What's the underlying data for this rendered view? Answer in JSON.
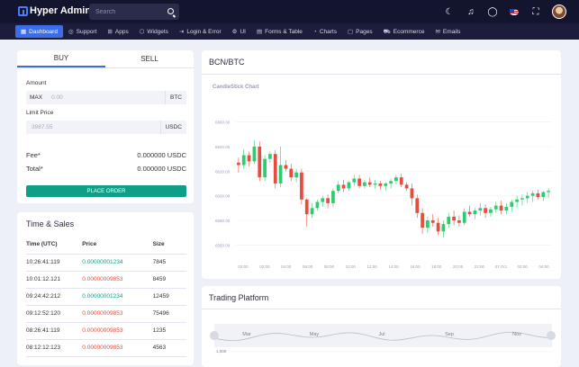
{
  "app": {
    "title": "Hyper Admin"
  },
  "search": {
    "placeholder": "Search"
  },
  "topbar": {
    "icons": [
      "moon-icon",
      "bell-icon",
      "chat-icon",
      "flag-us-icon",
      "fullscreen-icon",
      "avatar"
    ]
  },
  "nav": [
    {
      "label": "Dashboard",
      "icon": "▦",
      "active": true
    },
    {
      "label": "Support",
      "icon": "◎"
    },
    {
      "label": "Apps",
      "icon": "⊞"
    },
    {
      "label": "Widgets",
      "icon": "⬡"
    },
    {
      "label": "Login & Error",
      "icon": "⇥"
    },
    {
      "label": "UI",
      "icon": "⚙"
    },
    {
      "label": "Forms & Table",
      "icon": "▤"
    },
    {
      "label": "Charts",
      "icon": "◔"
    },
    {
      "label": "Pages",
      "icon": "▢"
    },
    {
      "label": "Ecommerce",
      "icon": "⛟"
    },
    {
      "label": "Emails",
      "icon": "✉"
    }
  ],
  "trade": {
    "buy_tab": "BUY",
    "sell_tab": "SELL",
    "amount_label": "Amount",
    "amount_prefix": "MAX",
    "amount_value": "0.00",
    "amount_suffix": "BTC",
    "limit_label": "Limit Price",
    "limit_value": "3987.55",
    "limit_suffix": "USDC",
    "fee_label": "Fee*",
    "fee_value": "0.000000 USDC",
    "total_label": "Total*",
    "total_value": "0.000000 USDC",
    "button": "PLACE ORDER"
  },
  "time_sales": {
    "title": "Time & Sales",
    "headers": [
      "Time (UTC)",
      "Price",
      "Size"
    ],
    "rows": [
      {
        "time": "10:26:41:119",
        "price": "0.00000001234",
        "size": "7845",
        "dir": "up"
      },
      {
        "time": "10:01:12.121",
        "price": "0.00000009853",
        "size": "8459",
        "dir": "dn"
      },
      {
        "time": "09:24:42:212",
        "price": "0.00000001234",
        "size": "12459",
        "dir": "up"
      },
      {
        "time": "09:12:52:120",
        "price": "0.00000009853",
        "size": "75496",
        "dir": "dn"
      },
      {
        "time": "08:26:41:119",
        "price": "0.00000009853",
        "size": "1235",
        "dir": "dn"
      },
      {
        "time": "08:12:12:123",
        "price": "0.00000009853",
        "size": "4563",
        "dir": "dn"
      }
    ]
  },
  "chart_card": {
    "title": "BCN/BTC"
  },
  "chart_data": {
    "type": "candlestick",
    "title": "CandleStick Chart",
    "y_ticks": [
      "6660.00",
      "6640.00",
      "6620.00",
      "6600.00",
      "6580.00",
      "6560.00"
    ],
    "ylim": [
      6550,
      6670
    ],
    "x_ticks": [
      "03:00",
      "02:00",
      "04:00",
      "06:00",
      "08:00",
      "10:00",
      "12:00",
      "14:00",
      "16:00",
      "18:00",
      "20:00",
      "22:00",
      "07 Oct",
      "02:00",
      "04:00"
    ],
    "up_color": "#2ecc71",
    "down_color": "#e74c3c",
    "candles": [
      [
        6627,
        6631,
        6619,
        6625
      ],
      [
        6625,
        6638,
        6622,
        6633
      ],
      [
        6633,
        6636,
        6624,
        6628
      ],
      [
        6628,
        6645,
        6626,
        6640
      ],
      [
        6640,
        6644,
        6612,
        6615
      ],
      [
        6615,
        6633,
        6612,
        6630
      ],
      [
        6630,
        6636,
        6627,
        6634
      ],
      [
        6634,
        6637,
        6606,
        6610
      ],
      [
        6610,
        6640,
        6607,
        6625
      ],
      [
        6625,
        6629,
        6620,
        6622
      ],
      [
        6622,
        6626,
        6612,
        6615
      ],
      [
        6615,
        6622,
        6611,
        6619
      ],
      [
        6619,
        6622,
        6593,
        6597
      ],
      [
        6597,
        6598,
        6575,
        6585
      ],
      [
        6585,
        6594,
        6582,
        6590
      ],
      [
        6590,
        6597,
        6588,
        6595
      ],
      [
        6595,
        6600,
        6591,
        6598
      ],
      [
        6598,
        6601,
        6590,
        6594
      ],
      [
        6594,
        6606,
        6591,
        6604
      ],
      [
        6604,
        6612,
        6602,
        6609
      ],
      [
        6609,
        6613,
        6603,
        6606
      ],
      [
        6606,
        6612,
        6604,
        6611
      ],
      [
        6611,
        6617,
        6608,
        6614
      ],
      [
        6614,
        6617,
        6606,
        6608
      ],
      [
        6608,
        6613,
        6606,
        6611
      ],
      [
        6611,
        6615,
        6607,
        6609
      ],
      [
        6609,
        6613,
        6606,
        6610
      ],
      [
        6610,
        6612,
        6605,
        6608
      ],
      [
        6608,
        6611,
        6604,
        6610
      ],
      [
        6610,
        6614,
        6606,
        6612
      ],
      [
        6612,
        6617,
        6609,
        6615
      ],
      [
        6615,
        6618,
        6607,
        6609
      ],
      [
        6609,
        6611,
        6604,
        6606
      ],
      [
        6606,
        6610,
        6592,
        6598
      ],
      [
        6598,
        6601,
        6582,
        6586
      ],
      [
        6586,
        6590,
        6569,
        6574
      ],
      [
        6574,
        6583,
        6570,
        6580
      ],
      [
        6580,
        6585,
        6575,
        6578
      ],
      [
        6578,
        6582,
        6568,
        6571
      ],
      [
        6571,
        6580,
        6566,
        6577
      ],
      [
        6577,
        6586,
        6574,
        6583
      ],
      [
        6583,
        6588,
        6576,
        6580
      ],
      [
        6580,
        6584,
        6575,
        6578
      ],
      [
        6578,
        6590,
        6576,
        6587
      ],
      [
        6587,
        6592,
        6583,
        6585
      ],
      [
        6585,
        6590,
        6581,
        6588
      ],
      [
        6588,
        6594,
        6584,
        6590
      ],
      [
        6590,
        6593,
        6582,
        6586
      ],
      [
        6586,
        6591,
        6583,
        6589
      ],
      [
        6589,
        6595,
        6586,
        6592
      ],
      [
        6592,
        6596,
        6585,
        6588
      ],
      [
        6588,
        6594,
        6585,
        6591
      ],
      [
        6591,
        6597,
        6587,
        6595
      ],
      [
        6595,
        6600,
        6590,
        6597
      ],
      [
        6597,
        6601,
        6592,
        6598
      ],
      [
        6598,
        6603,
        6594,
        6600
      ],
      [
        6600,
        6604,
        6595,
        6602
      ],
      [
        6602,
        6605,
        6597,
        6599
      ],
      [
        6599,
        6604,
        6596,
        6603
      ],
      [
        6603,
        6606,
        6598,
        6604
      ]
    ]
  },
  "platform": {
    "title": "Trading Platform",
    "months": [
      "Mar",
      "May",
      "Jul",
      "Sep",
      "Nov"
    ],
    "y_tick": "1,000"
  }
}
